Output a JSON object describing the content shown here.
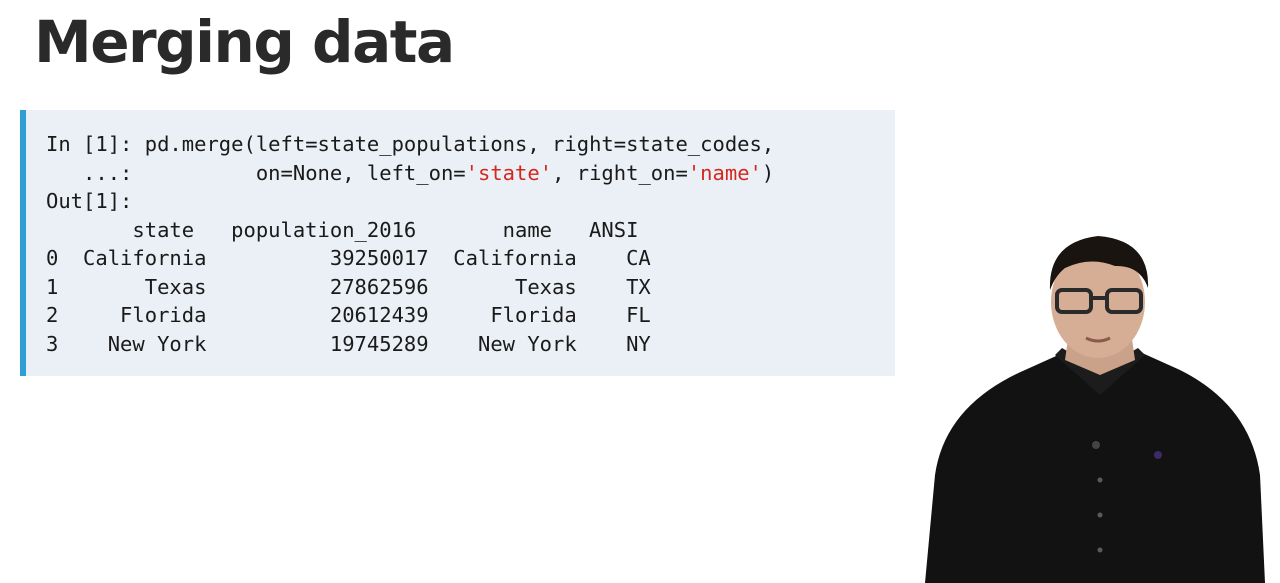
{
  "slide": {
    "title": "Merging data"
  },
  "code": {
    "in_prompt": "In [1]: ",
    "call_line1": "pd.merge(left=state_populations, right=state_codes,",
    "cont_prompt": "   ...: ",
    "call_line2_a": "         on=None, left_on=",
    "left_on_value": "'state'",
    "call_line2_b": ", right_on=",
    "right_on_value": "'name'",
    "call_line2_c": ")",
    "out_prompt": "Out[1]:"
  },
  "table": {
    "header": "       state   population_2016       name   ANSI",
    "rows": [
      "0  California          39250017  California    CA",
      "1       Texas          27862596       Texas    TX",
      "2     Florida          20612439     Florida    FL",
      "3    New York          19745289    New York    NY"
    ]
  },
  "colors": {
    "accent_bar": "#2e9fd2",
    "code_background": "#eaf0f5",
    "string_literal": "#d4271f"
  }
}
